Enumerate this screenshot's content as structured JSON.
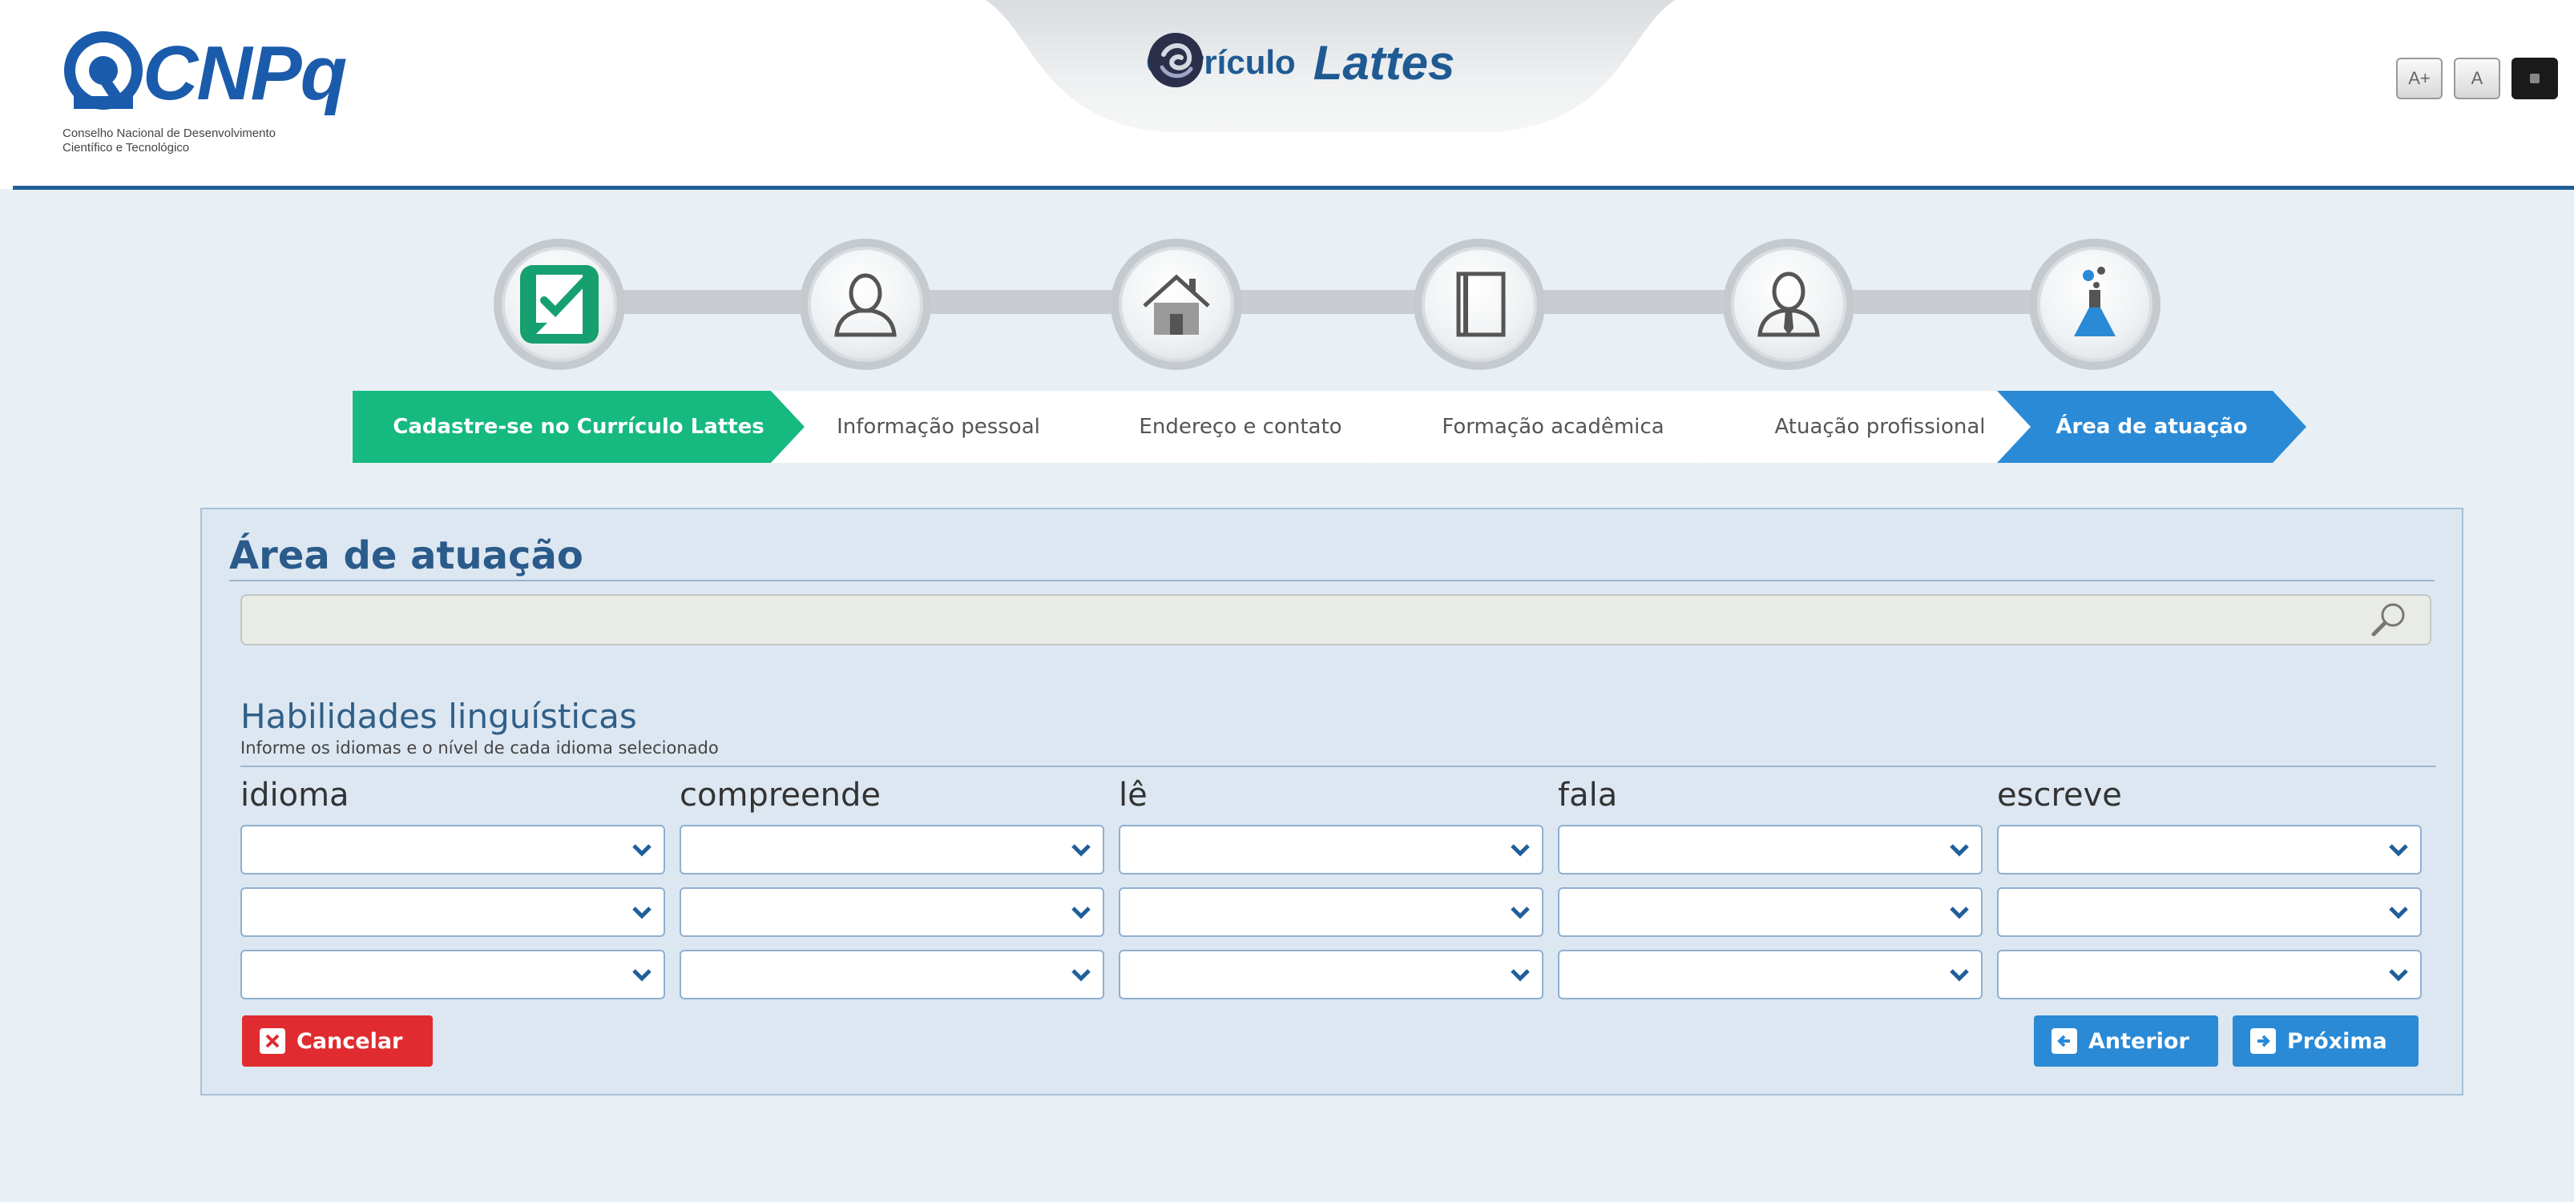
{
  "header": {
    "logo_text": "CNPq",
    "logo_subtitle_line1": "Conselho Nacional de Desenvolvimento",
    "logo_subtitle_line2": "Científico e Tecnológico",
    "app_title_prefix": "Currículo",
    "app_title_main": "Lattes",
    "font_controls": {
      "increase": "A+",
      "normal": "A"
    }
  },
  "steps": [
    {
      "label": "Cadastre-se no Currículo Lattes",
      "state": "done",
      "icon": "checklist-icon"
    },
    {
      "label": "Informação pessoal",
      "state": "pending",
      "icon": "person-icon"
    },
    {
      "label": "Endereço e contato",
      "state": "pending",
      "icon": "house-icon"
    },
    {
      "label": "Formação acadêmica",
      "state": "pending",
      "icon": "book-icon"
    },
    {
      "label": "Atuação profissional",
      "state": "pending",
      "icon": "professional-icon"
    },
    {
      "label": "Área de atuação",
      "state": "active",
      "icon": "flask-icon"
    }
  ],
  "panel": {
    "title": "Área de atuação",
    "search": {
      "value": "",
      "placeholder": ""
    },
    "languages": {
      "title": "Habilidades linguísticas",
      "subtitle": "Informe os idiomas e o nível de cada idioma selecionado",
      "columns": [
        "idioma",
        "compreende",
        "lê",
        "fala",
        "escreve"
      ],
      "rows": [
        [
          "",
          "",
          "",
          "",
          ""
        ],
        [
          "",
          "",
          "",
          "",
          ""
        ],
        [
          "",
          "",
          "",
          "",
          ""
        ]
      ]
    }
  },
  "actions": {
    "cancel": "Cancelar",
    "previous": "Anterior",
    "next": "Próxima"
  },
  "colors": {
    "brand_blue": "#1b5bab",
    "done_green": "#16b97f",
    "active_blue": "#2a8ad6",
    "cancel_red": "#e02c30",
    "panel_bg": "#dde7f1"
  }
}
